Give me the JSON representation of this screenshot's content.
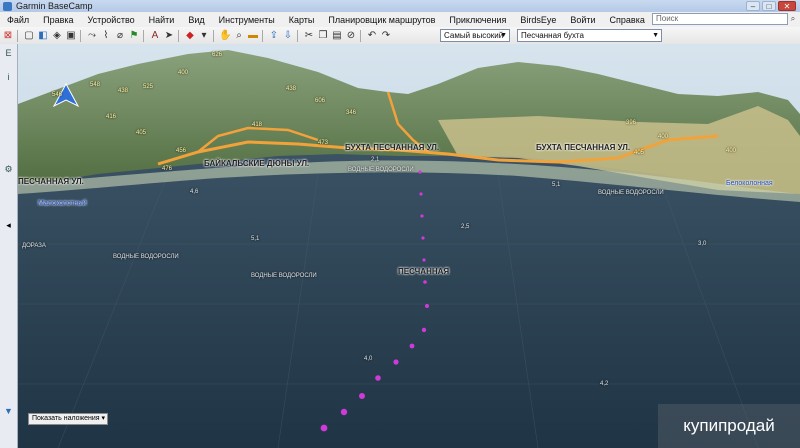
{
  "window": {
    "title": "Garmin BaseCamp"
  },
  "menu": [
    "Файл",
    "Правка",
    "Устройство",
    "Найти",
    "Вид",
    "Инструменты",
    "Карты",
    "Планировщик маршрутов",
    "Приключения",
    "BirdsEye",
    "Войти",
    "Справка"
  ],
  "search": {
    "placeholder": "Поиск"
  },
  "toolbar": {
    "detail_select": "Самый высокий",
    "place_select": "Песчанная бухта"
  },
  "overlay_button": "Показать наложения",
  "map_labels": {
    "beach_left": "ПЕСЧАННАЯ УЛ.",
    "beach_center": "БУХТА ПЕСЧАННАЯ УЛ.",
    "beach_right": "БУХТА ПЕСЧАННАЯ УЛ.",
    "dunes": "БАЙКАЛЬСКИЕ ДЮНЫ УЛ.",
    "hotels": "Малоколотный",
    "point_right": "Белоколонная",
    "bay": "ПЕСЧАННАЯ",
    "lbl1": "ДОРАЗА",
    "lbl2": "ВОДНЫЕ ВОДОРОСЛИ",
    "lbl3": "ВОДНЫЕ ВОДОРОСЛИ",
    "lbl4": "ВОДНЫЕ ВОДОРОСЛИ",
    "lbl5": "ВОДНЫЕ ВОДОРОСЛИ",
    "depth1": "2,1",
    "depth2": "4,6",
    "depth3": "5,1",
    "depth4": "5,1",
    "depth5": "2,5",
    "depth6": "3,0",
    "depth7": "4,0",
    "depth8": "4,2",
    "e1": "548",
    "e2": "626",
    "e3": "438",
    "e4": "525",
    "e5": "438",
    "e6": "400",
    "e7": "416",
    "e8": "346",
    "e9": "405",
    "e10": "456",
    "e11": "473",
    "e12": "546",
    "e13": "606",
    "e14": "396",
    "e15": "400",
    "e16": "405",
    "e17": "418",
    "e18": "400",
    "e19": "476"
  },
  "watermark": "купипродай",
  "colors": {
    "sea": "#2b4152",
    "road": "#f2a23a",
    "track": "#d03ad8",
    "land": "#6c8a5a"
  }
}
